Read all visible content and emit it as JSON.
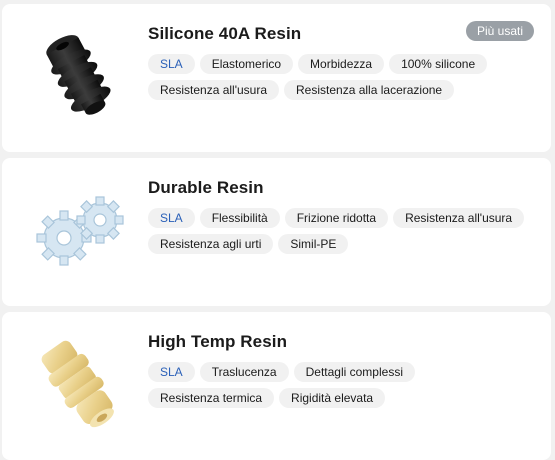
{
  "materials": [
    {
      "name": "Silicone 40A Resin",
      "badge": "Più usati",
      "tags": [
        "SLA",
        "Elastomerico",
        "Morbidezza",
        "100% silicone",
        "Resistenza all'usura",
        "Resistenza alla lacerazione"
      ]
    },
    {
      "name": "Durable Resin",
      "tags": [
        "SLA",
        "Flessibilità",
        "Frizione ridotta",
        "Resistenza all'usura",
        "Resistenza agli urti",
        "Simil-PE"
      ]
    },
    {
      "name": "High Temp Resin",
      "tags": [
        "SLA",
        "Traslucenza",
        "Dettagli complessi",
        "Resistenza termica",
        "Rigidità elevata"
      ]
    }
  ],
  "colors": {
    "sla_tag": "#2a60b8",
    "badge_bg": "#9aa0a6",
    "chip_bg": "#f1f1f1"
  }
}
